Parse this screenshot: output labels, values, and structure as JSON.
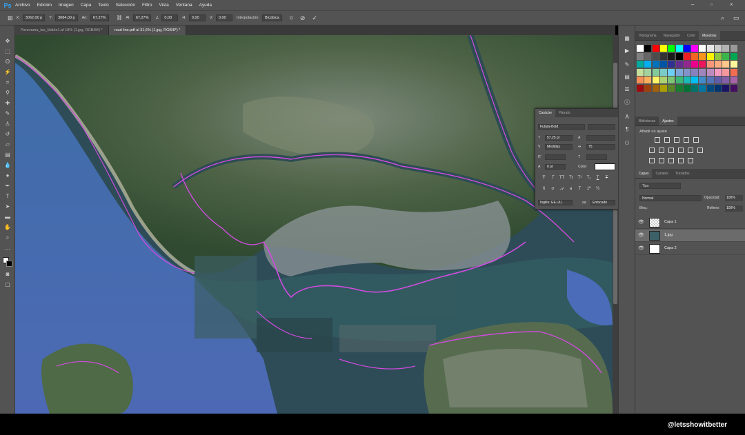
{
  "app": {
    "logo": "Ps"
  },
  "menu": [
    "Archivo",
    "Edición",
    "Imagen",
    "Capa",
    "Texto",
    "Selección",
    "Filtro",
    "Vista",
    "Ventana",
    "Ayuda"
  ],
  "options_bar": {
    "x_label": "X:",
    "x_value": "3062,00 p",
    "y_label": "Y:",
    "y_value": "3084,00 p",
    "w_label": "An:",
    "w_value": "67,27%",
    "h_label": "Al:",
    "h_value": "67,27%",
    "angle_value": "0,00",
    "hskew_label": "H:",
    "hskew_value": "0,00",
    "vskew_label": "V:",
    "vskew_value": "0,00",
    "interp_label": "Interpolación:",
    "interp_value": "Bicúbica"
  },
  "tabs": [
    {
      "label": "Panorama_las_Malde1.af 18% (1.jpg, RGB/8#) *",
      "active": false
    },
    {
      "label": "road line.pdf al 31,6% (1.jpg, RGB/8*) *",
      "active": true
    }
  ],
  "swatches_panel": {
    "tabs": [
      "Histograma",
      "Navegador",
      "Color",
      "Muestras"
    ],
    "active": "Muestras"
  },
  "adjust_panel": {
    "tabs": [
      "Bibliotecas",
      "Ajustes"
    ],
    "active": "Ajustes",
    "header": "Añadir un ajuste"
  },
  "layers_panel": {
    "tabs": [
      "Capas",
      "Canales",
      "Trazados"
    ],
    "active": "Capas",
    "filter_placeholder": "Tipo",
    "blend_mode": "Normal",
    "opacity_label": "Opacidad:",
    "opacity_value": "100%",
    "lock_label": "Bloq.:",
    "fill_label": "Relleno:",
    "fill_value": "100%",
    "layers": [
      {
        "name": "Capa 1",
        "selected": false
      },
      {
        "name": "1.jpg",
        "selected": true
      },
      {
        "name": "Capa 2",
        "selected": false
      }
    ]
  },
  "character_panel": {
    "tabs": [
      "Carácter",
      "Párrafo"
    ],
    "active": "Carácter",
    "font_family": "Futura-Bold",
    "font_size": "57,25 pt",
    "tracking": "Medidas",
    "kerning": "75",
    "leading": "0 pt",
    "color_label": "Color:",
    "language": "Inglés: EE.UU.",
    "antialias": "Enfocado"
  },
  "watermark": "@letsshowitbetter",
  "colors": {
    "panel_bg": "#535353",
    "selection": "#6b6b6b",
    "accent": "#31a8ff",
    "roadline": "#d24be0"
  }
}
